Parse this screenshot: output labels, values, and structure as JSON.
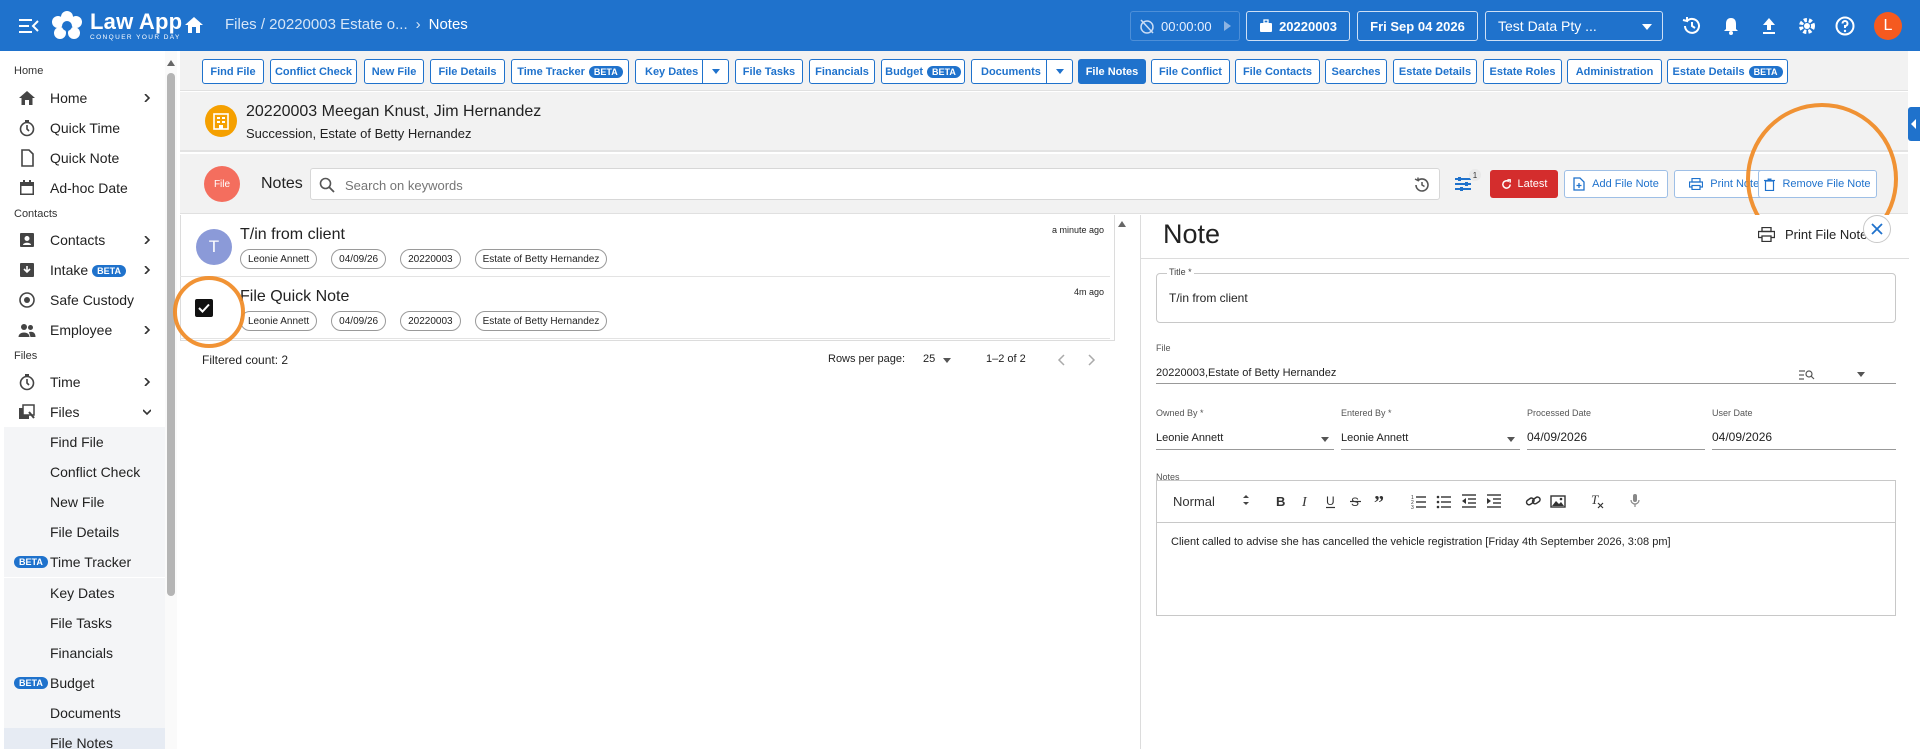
{
  "app": {
    "name": "Law App",
    "tagline": "CONQUER YOUR DAY",
    "breadcrumb_path": "Files / 20220003 Estate o...",
    "breadcrumb_current": "Notes",
    "timer": "00:00:00",
    "file_number": "20220003",
    "date": "Fri Sep 04 2026",
    "company": "Test Data Pty ...",
    "avatar_letter": "L",
    "brand_color": "#1f72cc"
  },
  "sidebar": {
    "sections": {
      "home": "Home",
      "contacts": "Contacts",
      "files": "Files"
    },
    "home_items": [
      {
        "label": "Home",
        "icon": "home-icon"
      },
      {
        "label": "Quick Time",
        "icon": "stopwatch-icon"
      },
      {
        "label": "Quick Note",
        "icon": "note-icon"
      },
      {
        "label": "Ad-hoc Date",
        "icon": "calendar-icon"
      }
    ],
    "contact_items": [
      {
        "label": "Contacts",
        "icon": "contacts-icon"
      },
      {
        "label": "Intake",
        "icon": "intake-icon",
        "badge": "BETA"
      },
      {
        "label": "Safe Custody",
        "icon": "safe-icon"
      },
      {
        "label": "Employee",
        "icon": "people-icon"
      }
    ],
    "file_items": [
      {
        "label": "Time",
        "icon": "stopwatch-icon"
      },
      {
        "label": "Files",
        "icon": "files-icon"
      }
    ],
    "file_subitems": [
      {
        "label": "Find File"
      },
      {
        "label": "Conflict Check"
      },
      {
        "label": "New File"
      },
      {
        "label": "File Details"
      },
      {
        "label": "Time Tracker",
        "badge": "BETA"
      },
      {
        "label": "Key Dates"
      },
      {
        "label": "File Tasks"
      },
      {
        "label": "Financials"
      },
      {
        "label": "Budget",
        "badge": "BETA"
      },
      {
        "label": "Documents"
      },
      {
        "label": "File Notes"
      }
    ]
  },
  "tabs": [
    {
      "label": "Find File"
    },
    {
      "label": "Conflict Check"
    },
    {
      "label": "New File"
    },
    {
      "label": "File Details"
    },
    {
      "label": "Time Tracker",
      "badge": "BETA"
    },
    {
      "label": "Key Dates"
    },
    {
      "label": "File Tasks"
    },
    {
      "label": "Financials"
    },
    {
      "label": "Budget",
      "badge": "BETA"
    },
    {
      "label": "Documents"
    },
    {
      "label": "File Notes",
      "active": true
    },
    {
      "label": "File Conflict"
    },
    {
      "label": "File Contacts"
    },
    {
      "label": "Searches"
    },
    {
      "label": "Estate Details"
    },
    {
      "label": "Estate Roles"
    },
    {
      "label": "Administration"
    },
    {
      "label": "Estate Details",
      "badge": "BETA"
    }
  ],
  "file": {
    "title": "20220003 Meegan Knust, Jim Hernandez",
    "subtitle": "Succession, Estate of Betty Hernandez"
  },
  "notes_bar": {
    "chip": "File",
    "label": "Notes",
    "search_placeholder": "Search on keywords",
    "filter_count": "1",
    "latest": "Latest",
    "add": "Add File Note",
    "print": "Print Notes",
    "remove": "Remove File Note"
  },
  "notes": [
    {
      "avatar": "T",
      "title": "T/in from client",
      "when": "a minute ago",
      "chips": [
        "Leonie Annett",
        "04/09/26",
        "20220003",
        "Estate of Betty Hernandez"
      ]
    },
    {
      "avatar": "",
      "title": "File Quick Note",
      "when": "4m ago",
      "chips": [
        "Leonie Annett",
        "04/09/26",
        "20220003",
        "Estate of Betty Hernandez"
      ],
      "checked": true
    }
  ],
  "pager": {
    "filtered": "Filtered count: 2",
    "rows_label": "Rows per page:",
    "rows_value": "25",
    "range": "1–2 of 2"
  },
  "note_detail": {
    "heading": "Note",
    "print": "Print File Note",
    "title_label": "Title *",
    "title_value": "T/in from client",
    "file_label": "File",
    "file_value": "20220003,Estate of Betty Hernandez",
    "owned_label": "Owned By *",
    "owned_value": "Leonie Annett",
    "entered_label": "Entered By *",
    "entered_value": "Leonie Annett",
    "processed_label": "Processed Date",
    "processed_value": "04/09/2026",
    "user_label": "User Date",
    "user_value": "04/09/2026",
    "notes_label": "Notes",
    "format": "Normal",
    "body": "Client called to advise she has cancelled the vehicle registration [Friday 4th September 2026, 3:08 pm]"
  }
}
